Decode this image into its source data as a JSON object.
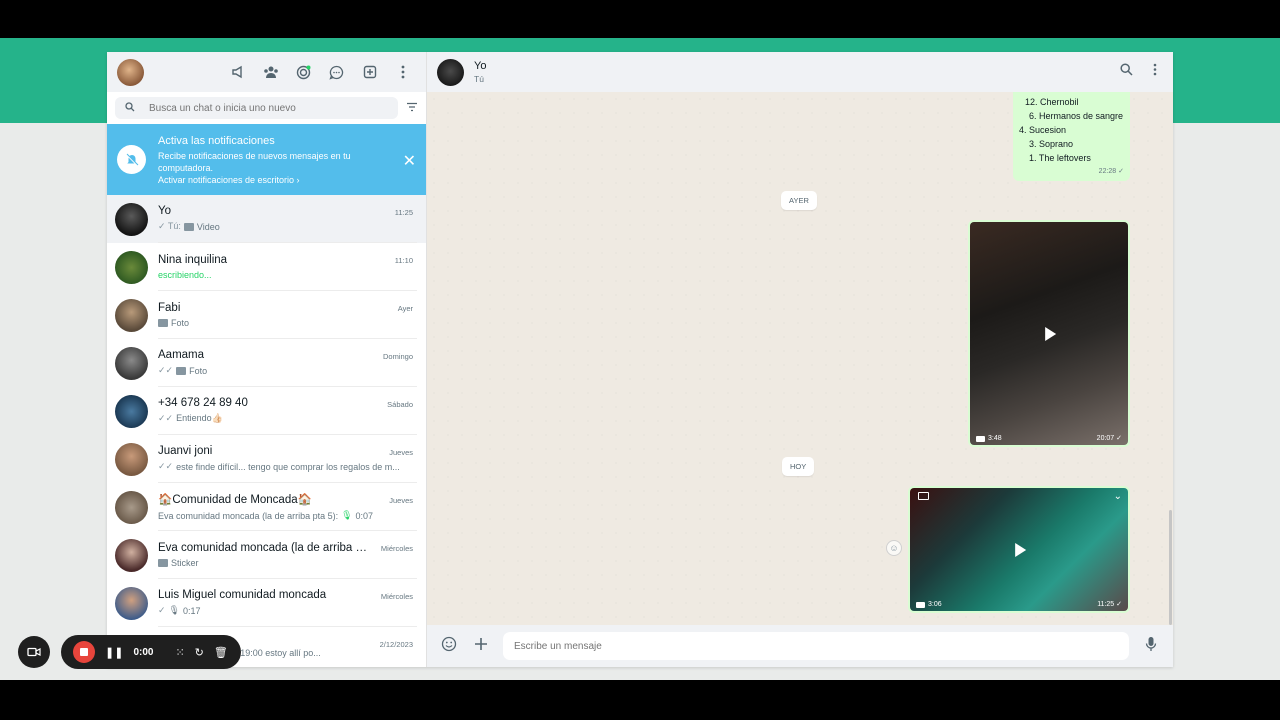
{
  "left": {
    "search_placeholder": "Busca un chat o inicia uno nuevo",
    "notification": {
      "title": "Activa las notificaciones",
      "body": "Recibe notificaciones de nuevos mensajes en tu computadora.",
      "link": "Activar notificaciones de escritorio ›"
    },
    "chats": [
      {
        "name": "Yo",
        "time": "11:25",
        "prefix": "✓ Tú:",
        "preview": "Video"
      },
      {
        "name": "Nina inquilina",
        "time": "11:10",
        "preview": "escribiendo..."
      },
      {
        "name": "Fabi",
        "time": "Ayer",
        "preview": "Foto"
      },
      {
        "name": "Aamama",
        "time": "Domingo",
        "prefix": "✓✓",
        "preview": "Foto"
      },
      {
        "name": "+34 678 24 89 40",
        "time": "Sábado",
        "prefix": "✓✓",
        "preview": "Entiendo👍🏻"
      },
      {
        "name": "Juanvi joni",
        "time": "Jueves",
        "prefix": "✓✓",
        "preview": "este finde difícil... tengo que comprar  los regalos de m..."
      },
      {
        "name": "🏠Comunidad de Moncada🏠",
        "time": "Jueves",
        "preview": "Eva comunidad moncada (la de arriba pta 5):",
        "extra": "0:07"
      },
      {
        "name": "Eva comunidad moncada (la de arriba pta...",
        "time": "Miércoles",
        "preview": "Sticker"
      },
      {
        "name": "Luis Miguel comunidad moncada",
        "time": "Miércoles",
        "prefix": "✓",
        "preview": "0:17"
      },
      {
        "name": "",
        "time": "2/12/2023",
        "preview": "\"Genial amic !! a las 19:00 estoy allí po..."
      }
    ]
  },
  "right": {
    "contact_name": "Yo",
    "contact_sub": "Tú",
    "list_lines": [
      "12. Chernobil",
      "6. Hermanos de sangre",
      "4.  Sucesion",
      "3. Soprano",
      "1. The leftovers"
    ],
    "list_time": "22:28 ✓",
    "date_yesterday": "AYER",
    "video1": {
      "duration": "3:48",
      "time": "20:07 ✓"
    },
    "date_today": "HOY",
    "video2": {
      "duration": "3:06",
      "time": "11:25 ✓"
    },
    "composer_placeholder": "Escribe un mensaje"
  },
  "recorder": {
    "time": "0:00"
  },
  "colors": {
    "brand_green": "#25b38a",
    "notif_blue": "#53bdeb",
    "outgoing_bubble": "#d9fdd3",
    "stop_red": "#e8453c"
  }
}
